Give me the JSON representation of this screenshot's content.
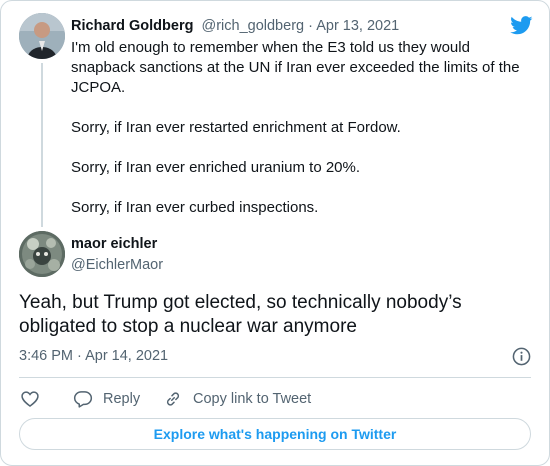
{
  "parent_tweet": {
    "author_name": "Richard Goldberg",
    "author_handle": "@rich_goldberg",
    "separator": "·",
    "date": "Apr 13, 2021",
    "paragraphs": [
      "I'm old enough to remember when the E3 told us they would snapback sanctions at the UN if Iran ever exceeded the limits of the JCPOA.",
      "Sorry, if Iran ever restarted enrichment at Fordow.",
      "Sorry, if Iran ever enriched uranium to 20%.",
      "Sorry, if Iran ever curbed inspections."
    ]
  },
  "tweet": {
    "author_name": "maor eichler",
    "author_handle": "@EichlerMaor",
    "text": "Yeah, but Trump got elected, so technically nobody’s obligated to stop a nuclear war anymore",
    "timestamp": "3:46 PM · Apr 14, 2021"
  },
  "actions": {
    "like_icon": "heart-icon",
    "reply_label": "Reply",
    "copy_label": "Copy link to Tweet"
  },
  "explore_label": "Explore what's happening on Twitter",
  "colors": {
    "twitter_blue": "#1d9bf0",
    "text_primary": "#0f1419",
    "text_secondary": "#536471",
    "border": "#cfd9de"
  }
}
